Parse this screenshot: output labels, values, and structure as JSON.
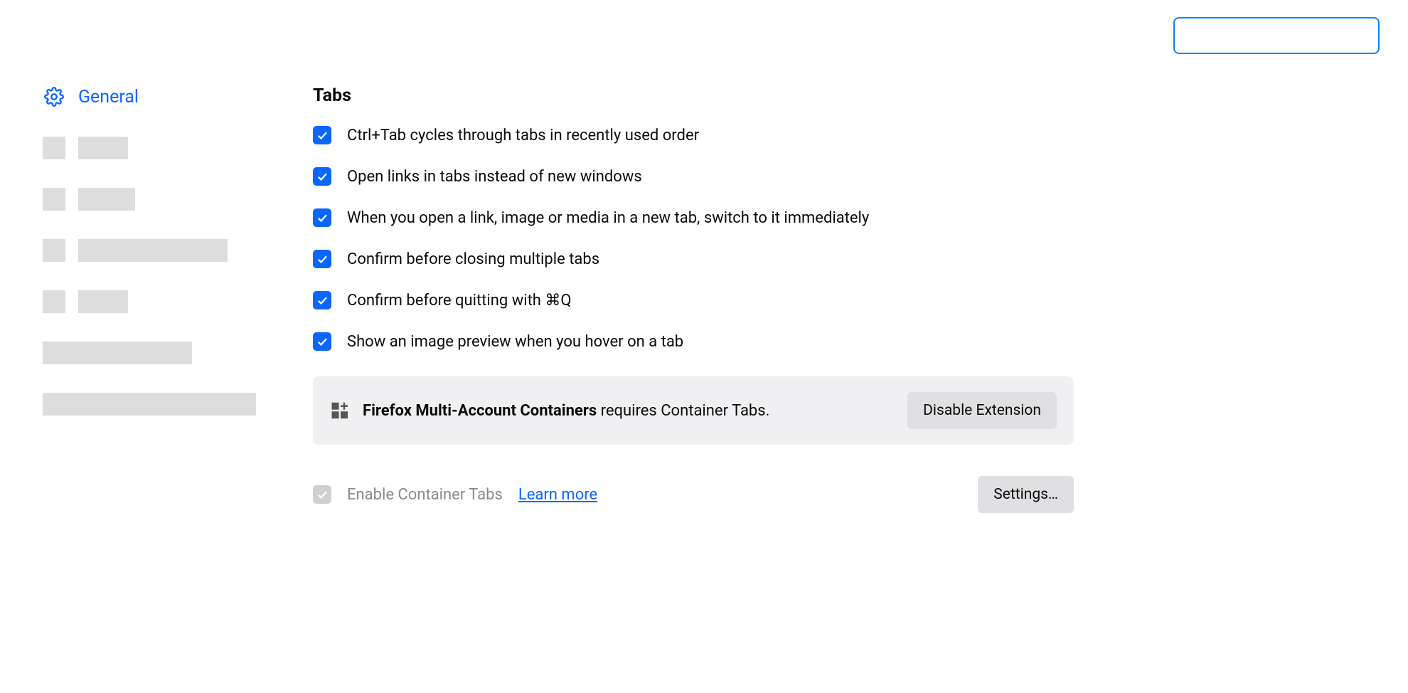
{
  "sidebar": {
    "general": "General"
  },
  "section": {
    "title": "Tabs"
  },
  "options": [
    {
      "label": "Ctrl+Tab cycles through tabs in recently used order",
      "checked": true
    },
    {
      "label": "Open links in tabs instead of new windows",
      "checked": true
    },
    {
      "label": "When you open a link, image or media in a new tab, switch to it immediately",
      "checked": true
    },
    {
      "label": "Confirm before closing multiple tabs",
      "checked": true
    },
    {
      "label": "Confirm before quitting with ⌘Q",
      "checked": true
    },
    {
      "label": "Show an image preview when you hover on a tab",
      "checked": true
    }
  ],
  "notice": {
    "extension": "Firefox Multi-Account Containers",
    "rest": " requires Container Tabs.",
    "button": "Disable Extension"
  },
  "containerTabs": {
    "label": "Enable Container Tabs",
    "learn": "Learn more",
    "settings": "Settings…"
  }
}
